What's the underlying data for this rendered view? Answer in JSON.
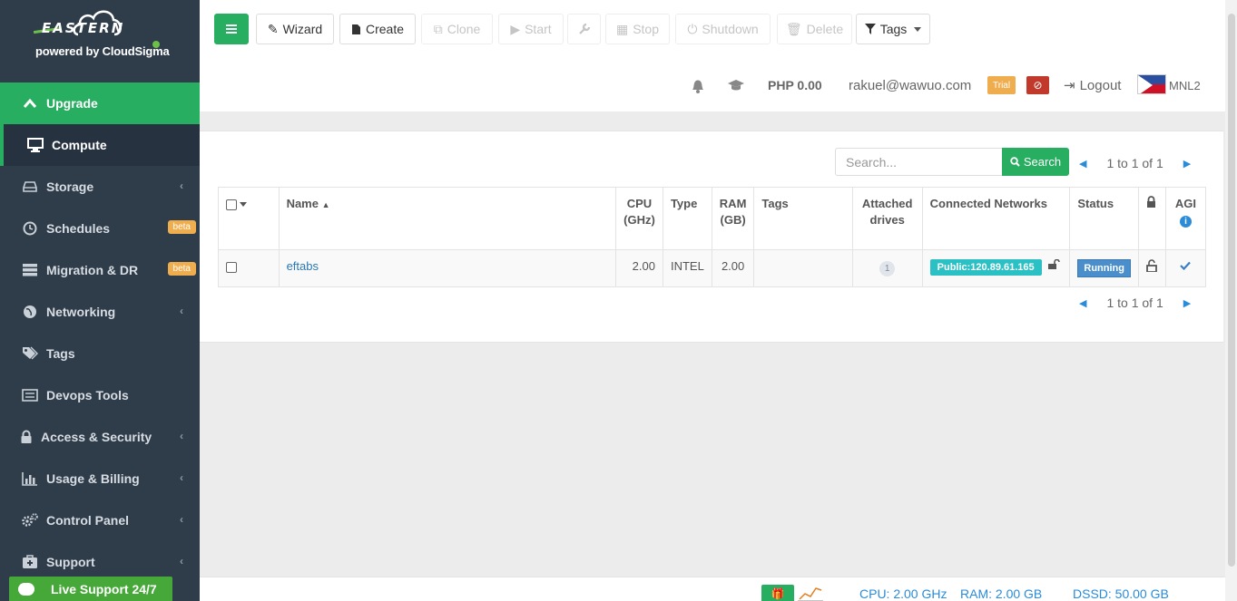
{
  "brand": {
    "name": "EASTERN",
    "tagline": "powered by CloudSigma"
  },
  "sidebar": {
    "items": [
      {
        "label": "Upgrade",
        "icon": "chevron-up-icon"
      },
      {
        "label": "Compute",
        "icon": "monitor-icon"
      },
      {
        "label": "Storage",
        "icon": "hdd-icon",
        "has_chevron": true
      },
      {
        "label": "Schedules",
        "icon": "clock-icon",
        "badge": "beta"
      },
      {
        "label": "Migration & DR",
        "icon": "server-stack-icon",
        "badge": "beta"
      },
      {
        "label": "Networking",
        "icon": "globe-icon",
        "has_chevron": true
      },
      {
        "label": "Tags",
        "icon": "tags-icon"
      },
      {
        "label": "Devops Tools",
        "icon": "devops-icon"
      },
      {
        "label": "Access & Security",
        "icon": "lock-icon",
        "has_chevron": true
      },
      {
        "label": "Usage & Billing",
        "icon": "bar-chart-icon",
        "has_chevron": true
      },
      {
        "label": "Control Panel",
        "icon": "gears-icon",
        "has_chevron": true
      },
      {
        "label": "Support",
        "icon": "medkit-icon",
        "has_chevron": true
      }
    ],
    "live_support": "Live Support 24/7"
  },
  "toolbar": {
    "wizard": "Wizard",
    "create": "Create",
    "clone": "Clone",
    "start": "Start",
    "stop": "Stop",
    "shutdown": "Shutdown",
    "delete": "Delete",
    "tags": "Tags"
  },
  "account": {
    "balance": "PHP 0.00",
    "email": "rakuel@wawuo.com",
    "trial": "Trial",
    "logout": "Logout",
    "region": "MNL2"
  },
  "search": {
    "placeholder": "Search...",
    "button": "Search"
  },
  "pagination": {
    "text": "1 to 1 of 1"
  },
  "table": {
    "headers": {
      "name": "Name",
      "cpu": "CPU (GHz)",
      "type": "Type",
      "ram": "RAM (GB)",
      "tags": "Tags",
      "drives": "Attached drives",
      "networks": "Connected Networks",
      "status": "Status",
      "agi": "AGI"
    },
    "rows": [
      {
        "name": "eftabs",
        "cpu": "2.00",
        "type": "INTEL",
        "ram": "2.00",
        "tags": "",
        "drives": "1",
        "network": "Public:120.89.61.165",
        "status": "Running"
      }
    ]
  },
  "footer": {
    "cpu": "CPU: 2.00 GHz",
    "ram": "RAM: 2.00 GB",
    "dssd": "DSSD: 50.00 GB"
  },
  "colors": {
    "accent": "#27ae60",
    "sidebar": "#2f3c4a",
    "link": "#2a78b5",
    "beta": "#f0ad4e"
  }
}
